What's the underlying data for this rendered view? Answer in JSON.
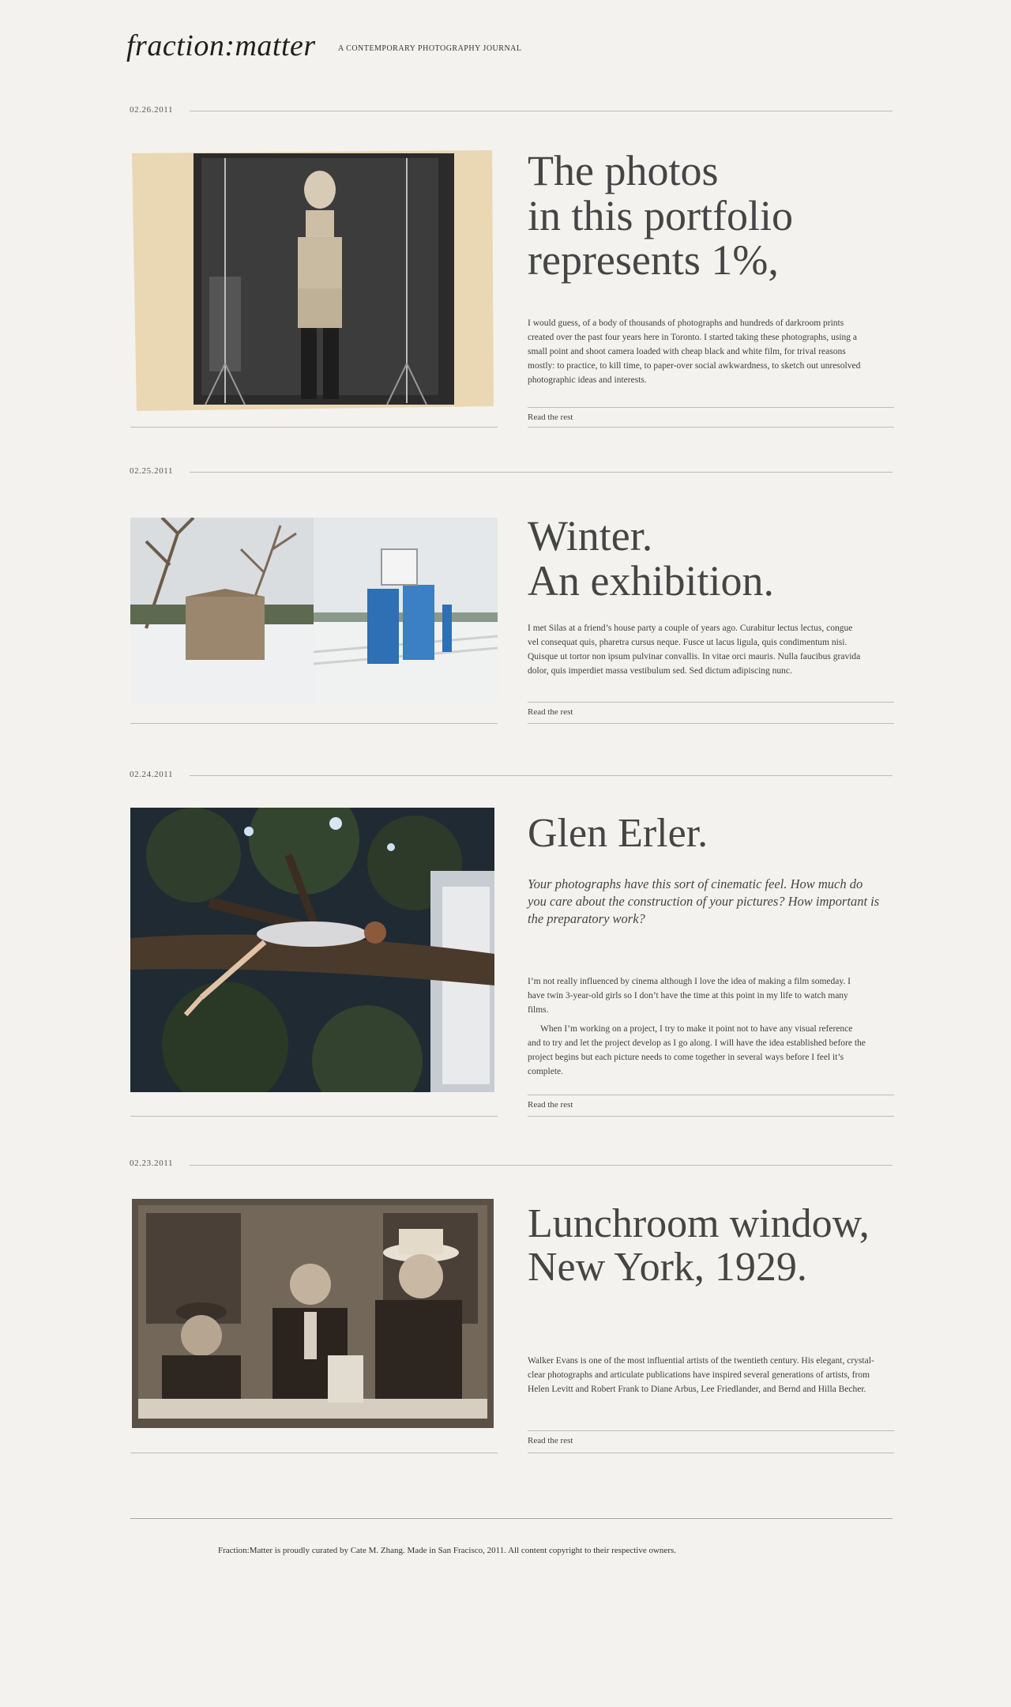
{
  "header": {
    "logo": "fraction:matter",
    "tagline": "A CONTEMPORARY PHOTOGRAPHY JOURNAL"
  },
  "posts": [
    {
      "date": "02.26.2011",
      "title_lines": [
        "The photos",
        "in this portfolio",
        "represents 1%,"
      ],
      "body": "I would guess, of a body of thousands of photographs and hundreds of darkroom prints created over the past four years here in Toronto. I started taking these photographs, using a small point and shoot camera loaded with cheap black and white film, for trival reasons mostly: to practice, to kill time, to paper-over social awkwardness, to sketch out unresolved photographic ideas and interests.",
      "read_more": "Read the rest"
    },
    {
      "date": "02.25.2011",
      "title_lines": [
        "Winter.",
        "An exhibition."
      ],
      "body": "I met Silas at a friend’s house party a couple of years ago. Curabitur lectus lectus, congue vel consequat quis, pharetra cursus neque. Fusce ut lacus ligula, quis condimentum nisi. Quisque ut tortor non ipsum pulvinar convallis. In vitae orci mauris. Nulla faucibus gravida dolor, quis imperdiet massa vestibulum sed. Sed dictum adipiscing nunc.",
      "read_more": "Read the rest"
    },
    {
      "date": "02.24.2011",
      "title_lines": [
        "Glen Erler."
      ],
      "question": "Your photographs have this sort of cinematic feel. How much do you care about the construction of your pictures? How important is the preparatory work?",
      "body": "I’m not really influenced by cinema although I love the idea of making a film someday. I have twin 3-year-old girls so I don’t have the time at this point in my life to watch many films.",
      "body2": "When I’m working on a project, I try to make it point not to have any visual reference and to try and let the project develop as I go along. I will have the idea established before the project begins but each picture needs to come together in several ways before I feel it’s complete.",
      "read_more": "Read the rest"
    },
    {
      "date": "02.23.2011",
      "title_lines": [
        "Lunchroom window,",
        "New York, 1929."
      ],
      "body": "Walker Evans is one of the most influential artists of the twentieth century. His elegant, crystal-clear photographs and articulate publications have inspired several generations of artists, from Helen Levitt and Robert Frank to Diane Arbus, Lee Friedlander, and Bernd and Hilla Becher.",
      "read_more": "Read the rest"
    }
  ],
  "footer": {
    "text": "Fraction:Matter is proudly curated by Cate M. Zhang. Made in San Fracisco, 2011.  All content copyright to their respective owners."
  }
}
